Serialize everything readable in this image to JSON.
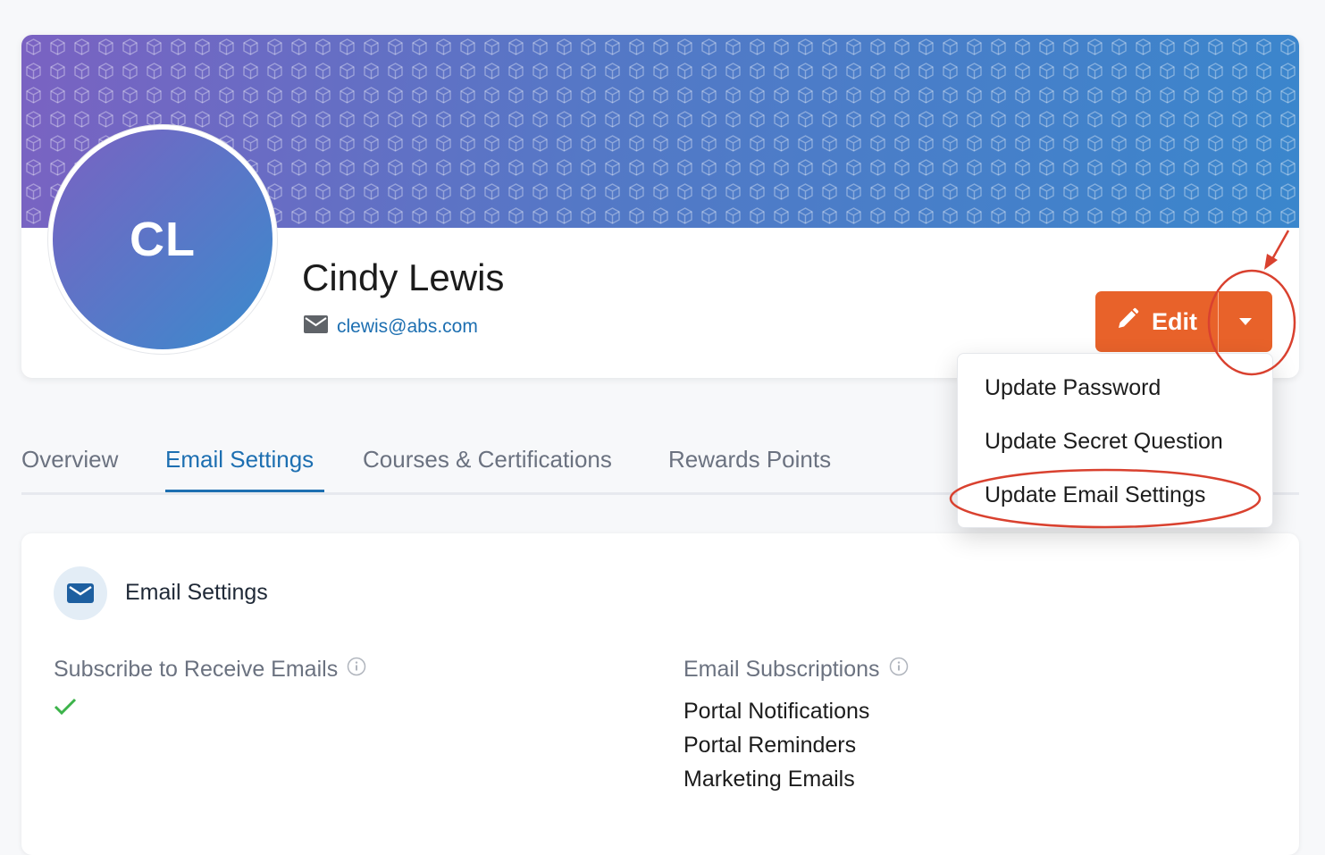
{
  "profile": {
    "initials": "CL",
    "name": "Cindy Lewis",
    "email": "clewis@abs.com"
  },
  "actions": {
    "edit_label": "Edit"
  },
  "dropdown": {
    "items": [
      "Update Password",
      "Update Secret Question",
      "Update Email Settings"
    ]
  },
  "tabs": [
    {
      "label": "Overview",
      "active": false
    },
    {
      "label": "Email Settings",
      "active": true
    },
    {
      "label": "Courses & Certifications",
      "active": false
    },
    {
      "label": "Rewards Points",
      "active": false
    }
  ],
  "email_settings": {
    "title": "Email Settings",
    "subscribe_label": "Subscribe to Receive Emails",
    "subscribe_value": true,
    "subscriptions_label": "Email Subscriptions",
    "subscriptions": [
      "Portal Notifications",
      "Portal Reminders",
      "Marketing Emails"
    ]
  },
  "colors": {
    "accent": "#1d6fb1",
    "edit_button": "#e8622a",
    "annotation": "#d9412f",
    "check": "#3cb34a"
  },
  "icons": {
    "email": "envelope-icon",
    "edit": "pencil-icon",
    "dropdown": "caret-down-icon",
    "info": "info-icon",
    "check": "check-icon"
  }
}
